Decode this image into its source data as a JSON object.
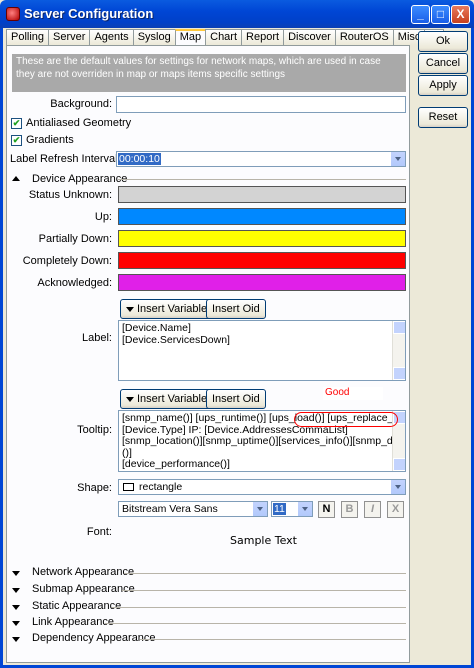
{
  "window": {
    "title": "Server Configuration",
    "controls": [
      "_",
      "□",
      "X"
    ]
  },
  "tabs": [
    {
      "label": "Polling",
      "active": false
    },
    {
      "label": "Server",
      "active": false
    },
    {
      "label": "Agents",
      "active": false
    },
    {
      "label": "Syslog",
      "active": false
    },
    {
      "label": "Map",
      "active": true
    },
    {
      "label": "Chart",
      "active": false
    },
    {
      "label": "Report",
      "active": false
    },
    {
      "label": "Discover",
      "active": false
    },
    {
      "label": "RouterOS",
      "active": false
    },
    {
      "label": "Misc",
      "active": false
    },
    {
      "label": "...",
      "active": false
    }
  ],
  "info_text": "These are the default values for settings for network maps, which are used in case they are not overriden in map or maps items specific settings",
  "buttons": {
    "ok": "Ok",
    "cancel": "Cancel",
    "apply": "Apply",
    "reset": "Reset"
  },
  "background": {
    "label": "Background:",
    "value": ""
  },
  "antialiased": {
    "label": "Antialiased Geometry",
    "checked": true
  },
  "gradients": {
    "label": "Gradients",
    "checked": true
  },
  "refresh": {
    "label": "Label Refresh Interval:",
    "value": "00:00:10"
  },
  "device_appearance": {
    "label": "Device Appearance",
    "colors": [
      {
        "label": "Status Unknown:",
        "color": "#d3d3d3"
      },
      {
        "label": "Up:",
        "color": "#0088ff"
      },
      {
        "label": "Partially Down:",
        "color": "#ffff00"
      },
      {
        "label": "Completely Down:",
        "color": "#ff0000"
      },
      {
        "label": "Acknowledged:",
        "color": "#e020e8"
      }
    ]
  },
  "insert_variable": "Insert Variable",
  "insert_oid": "Insert Oid",
  "label_field": {
    "label": "Label:",
    "lines": [
      "[Device.Name]",
      "[Device.ServicesDown]"
    ]
  },
  "annotation": {
    "text": "Good"
  },
  "tooltip_field": {
    "label": "Tooltip:",
    "lines": [
      "[snmp_name()] [ups_runtime()] [ups_load()] [ups_replace_battery()]",
      "[Device.Type] IP: [Device.AddressesCommaList]",
      "[snmp_location()][snmp_uptime()][services_info()][snmp_description",
      "()]",
      "[device_performance()]"
    ]
  },
  "shape": {
    "label": "Shape:",
    "value": "rectangle"
  },
  "font": {
    "label": "Font:",
    "family": "Bitstream Vera Sans",
    "size": "11",
    "style_buttons": [
      "N",
      "B",
      "I",
      "X"
    ],
    "sample": "Sample Text"
  },
  "sections": [
    "Network Appearance",
    "Submap Appearance",
    "Static Appearance",
    "Link Appearance",
    "Dependency Appearance"
  ],
  "colors": {
    "title_bar": "#0046d5",
    "info_bg": "#a9a9a9",
    "selection": "#316ac5",
    "annotation_red": "#ff0000"
  }
}
